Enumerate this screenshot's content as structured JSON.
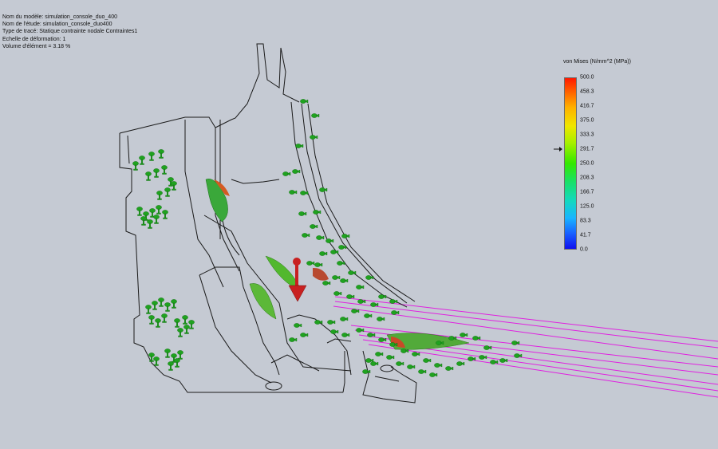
{
  "info": {
    "model_name": "Nom du modèle: simulation_console_duo_400",
    "study_name": "Nom de l'étude: simulation_console_duo400",
    "plot_type": "Type de tracé: Statique contrainte nodale Contraintes1",
    "deformation_scale": "Echelle de déformation: 1",
    "element_volume": "Volume d'élément = 3.18 %"
  },
  "legend": {
    "title": "von Mises (N/mm^2 (MPa))",
    "ticks": [
      "500.0",
      "458.3",
      "416.7",
      "375.0",
      "333.3",
      "291.7",
      "250.0",
      "208.3",
      "166.7",
      "125.0",
      "83.3",
      "41.7",
      "0.0"
    ],
    "yield_marker_icon": "arrow-right-icon"
  },
  "colors": {
    "background": "#c5cad3",
    "outline": "#1a1a1a",
    "fixture": "#1fa21f",
    "load": "#c82020",
    "connector": "#e020e0"
  }
}
